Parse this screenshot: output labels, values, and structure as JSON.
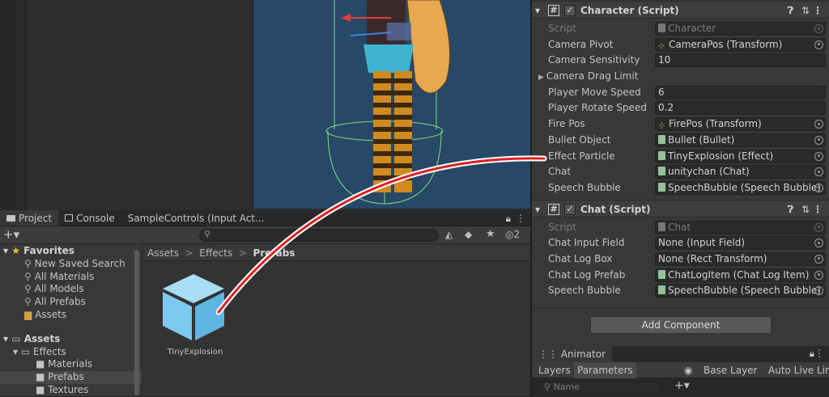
{
  "scene": {
    "label": "scene-view"
  },
  "project": {
    "tabs": [
      {
        "label": "Project",
        "icon": "folder-icon"
      },
      {
        "label": "Console",
        "icon": "console-icon"
      },
      {
        "label": "SampleControls (Input Act..."
      }
    ],
    "hidden_count": "2",
    "search_placeholder": "",
    "tree": {
      "favorites": "Favorites",
      "favorite_items": [
        "New Saved Search",
        "All Materials",
        "All Models",
        "All Prefabs"
      ],
      "favorites_assets": "Assets",
      "assets": "Assets",
      "effects": "Effects",
      "effects_children": [
        "Materials",
        "Prefabs",
        "Textures"
      ]
    },
    "breadcrumb": [
      "Assets",
      "Effects",
      "Prefabs"
    ],
    "asset_items": [
      {
        "label": "TinyExplosion",
        "icon": "prefab-cube-icon",
        "color": "#7cc9ef"
      }
    ]
  },
  "inspector": {
    "character": {
      "title": "Character (Script)",
      "rows": [
        {
          "label": "Script",
          "value": "Character",
          "dim": true
        },
        {
          "label": "Camera Pivot",
          "value": "CameraPos (Transform)"
        },
        {
          "label": "Camera Sensitivity",
          "value": "10"
        },
        {
          "label": "Camera Drag Limit",
          "value": ""
        },
        {
          "label": "Player Move Speed",
          "value": "6"
        },
        {
          "label": "Player Rotate Speed",
          "value": "0.2"
        },
        {
          "label": "Fire Pos",
          "value": "FirePos (Transform)"
        },
        {
          "label": "Bullet Object",
          "value": "Bullet (Bullet)"
        },
        {
          "label": "Effect Particle",
          "value": "TinyExplosion (Effect)"
        },
        {
          "label": "Chat",
          "value": "unitychan (Chat)"
        },
        {
          "label": "Speech Bubble",
          "value": "SpeechBubble (Speech Bubble)"
        }
      ]
    },
    "chat": {
      "title": "Chat (Script)",
      "rows": [
        {
          "label": "Script",
          "value": "Chat",
          "dim": true
        },
        {
          "label": "Chat Input Field",
          "value": "None (Input Field)"
        },
        {
          "label": "Chat Log Box",
          "value": "None (Rect Transform)"
        },
        {
          "label": "Chat Log Prefab",
          "value": "ChatLogItem (Chat Log Item)"
        },
        {
          "label": "Speech Bubble",
          "value": "SpeechBubble (Speech Bubble)"
        }
      ]
    },
    "add_component": "Add Component"
  },
  "animator": {
    "tab": "Animator",
    "layers": "Layers",
    "parameters": "Parameters",
    "base_layer": "Base Layer",
    "auto_live_link": "Auto Live Link",
    "search_placeholder": "Name"
  },
  "colors": {
    "drag_line": "#e02020",
    "accent": "#7cc9ef",
    "scene_bg": "#274866"
  }
}
